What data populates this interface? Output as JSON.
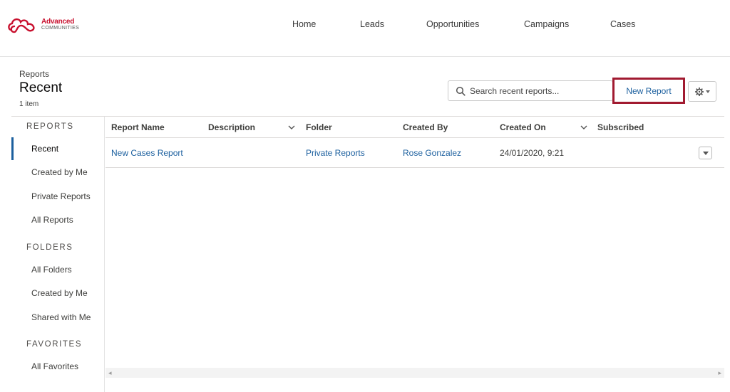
{
  "brand": {
    "line1": "Advanced",
    "line2": "COMMUNITIES",
    "color": "#c8102e"
  },
  "nav": {
    "items": [
      {
        "label": "Home"
      },
      {
        "label": "Leads"
      },
      {
        "label": "Opportunities"
      },
      {
        "label": "Campaigns"
      },
      {
        "label": "Cases"
      }
    ]
  },
  "page": {
    "breadcrumb": "Reports",
    "title": "Recent",
    "count": "1 item"
  },
  "search": {
    "placeholder": "Search recent reports...",
    "icon": "search-icon"
  },
  "toolbar": {
    "new_report_label": "New Report",
    "gear_icon": "gear-icon",
    "highlight_color": "#a11a30"
  },
  "sidebar": {
    "sections": [
      {
        "label": "REPORTS",
        "items": [
          {
            "label": "Recent",
            "active": true
          },
          {
            "label": "Created by Me"
          },
          {
            "label": "Private Reports"
          },
          {
            "label": "All Reports"
          }
        ]
      },
      {
        "label": "FOLDERS",
        "items": [
          {
            "label": "All Folders"
          },
          {
            "label": "Created by Me"
          },
          {
            "label": "Shared with Me"
          }
        ]
      },
      {
        "label": "FAVORITES",
        "items": [
          {
            "label": "All Favorites"
          }
        ]
      }
    ]
  },
  "table": {
    "columns": [
      {
        "label": "Report Name"
      },
      {
        "label": "Description"
      },
      {
        "label": "Folder"
      },
      {
        "label": "Created By"
      },
      {
        "label": "Created On"
      },
      {
        "label": "Subscribed"
      }
    ],
    "rows": [
      {
        "report_name": "New Cases Report",
        "description": "",
        "folder": "Private Reports",
        "created_by": "Rose Gonzalez",
        "created_on": "24/01/2020, 9:21",
        "subscribed": ""
      }
    ]
  },
  "colors": {
    "link": "#1b5f9e",
    "accent": "#1b5f9e"
  }
}
